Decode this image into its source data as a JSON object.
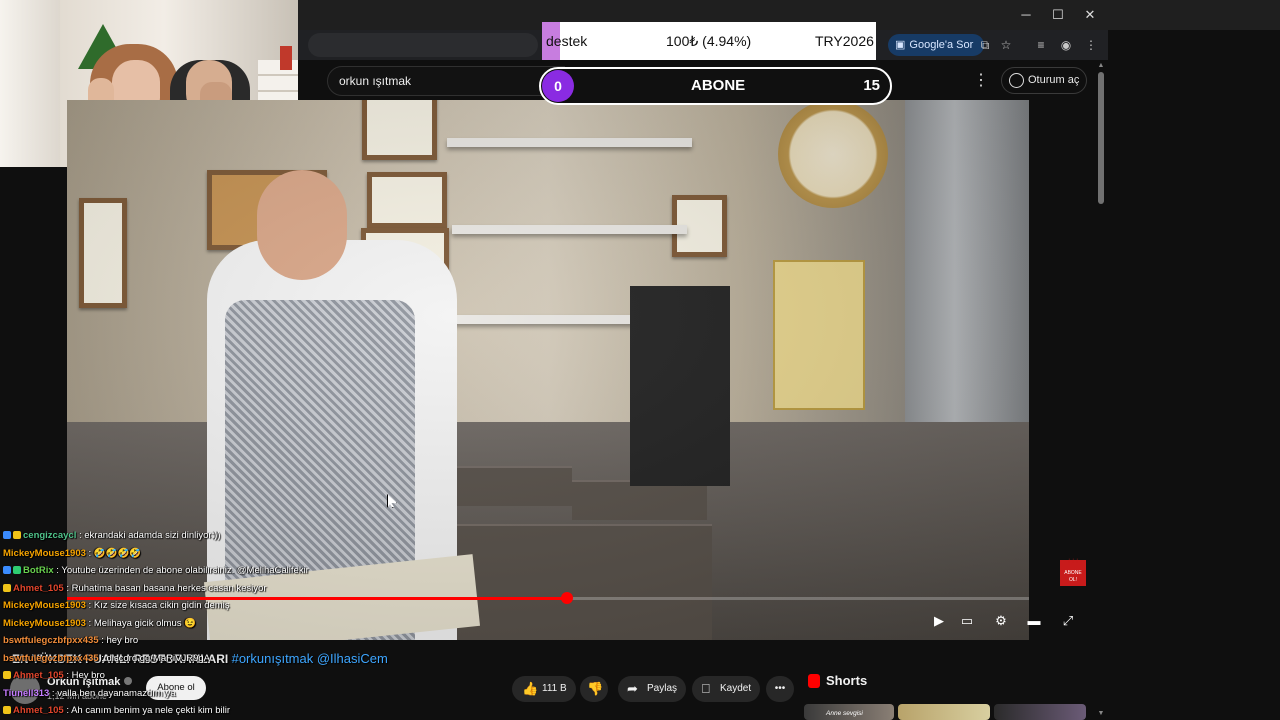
{
  "window": {
    "minimize": "─",
    "maximize": "☐",
    "close": "✕"
  },
  "toolbar": {
    "google_sor": "Google'a Sor"
  },
  "donation": {
    "label": "destek",
    "amount": "100₺ (4.94%)",
    "code": "TRY2026",
    "progress_fraction": 0.0494
  },
  "youtube": {
    "search_value": "orkun ışıtmak",
    "signin_label": "Oturum aç"
  },
  "subscribe_goal": {
    "current": "0",
    "label": "ABONE",
    "target": "15"
  },
  "video": {
    "progress_fraction": 0.52,
    "sub_badge": "ABONE OL!"
  },
  "chat": [
    {
      "user": "cengizcaycl",
      "text": ": ekrandaki adamda sizi dinliyor:))",
      "color": "#4fc38a",
      "badges": [
        "#3b8cff",
        "#f0c419"
      ]
    },
    {
      "user": "MickeyMouse1903",
      "text": ": 🤣🤣🤣🤣",
      "color": "#f7a400",
      "badges": []
    },
    {
      "user": "BotRix",
      "text": ": Youtube üzerinden de abone olabilirsiniz. @MelihaCalifekir",
      "color": "#69d14f",
      "badges": [
        "#3b8cff",
        "#2ecc71"
      ]
    },
    {
      "user": "Ahmet_105",
      "text": ": Ruhatima basan basana herkes casan kesiyor",
      "color": "#e0452c",
      "badges": [
        "#f0c419"
      ]
    },
    {
      "user": "MickeyMouse1903",
      "text": ": Kız size kısaca cikin gidin demiş",
      "color": "#f7a400",
      "badges": []
    },
    {
      "user": "MickeyMouse1903",
      "text": ": Melihaya gicik olmus 😉",
      "color": "#f7a400",
      "badges": []
    },
    {
      "user": "bswtfulegczbfpxx435",
      "text": ": hey bro",
      "color": "#f08c3a",
      "badges": []
    },
    {
      "user": "bswtfulegczbfpxx435",
      "text": ": discord.gg/MaRiVJR9gA",
      "color": "#f08c3a",
      "badges": []
    },
    {
      "user": "Ahmet_105",
      "text": ": Hey bro",
      "color": "#e0452c",
      "badges": [
        "#f0c419"
      ]
    },
    {
      "user": "Tiunell313",
      "text": ": valla ben dayanamazdım ya",
      "color": "#c57cff",
      "badges": []
    },
    {
      "user": "Ahmet_105",
      "text": ": Ah canım benim ya nele çekti kim bilir",
      "color": "#e0452c",
      "badges": [
        "#f0c419"
      ]
    }
  ],
  "below": {
    "title": "EN YÜKSEK PUANLI RESTORANLARI",
    "hashtag": "#orkunışıtmak @IlhasiCem",
    "channel": "Orkun Işıtmak",
    "subscribers": "1,12 Mn abone",
    "subscribe": "Abone ol",
    "likes": "111 B",
    "share": "Paylaş",
    "save": "Kaydet",
    "more": "•••"
  },
  "shorts": {
    "label": "Shorts",
    "thumb_caption": "Anne sevgisi"
  }
}
